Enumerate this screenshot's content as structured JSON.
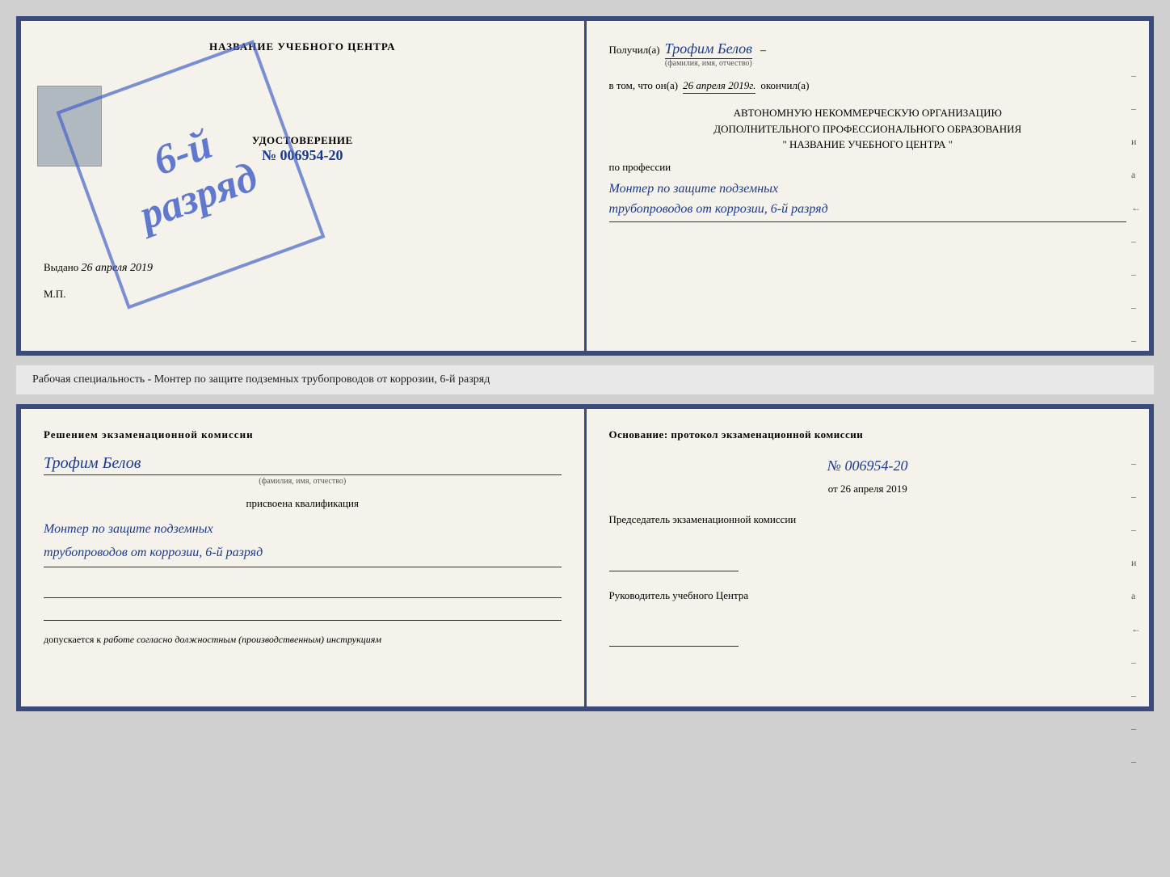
{
  "page": {
    "background": "#d0d0d0"
  },
  "top_doc": {
    "left": {
      "center_title": "НАЗВАНИЕ УЧЕБНОГО ЦЕНТРА",
      "stamp_line1": "6-й",
      "stamp_line2": "разряд",
      "cert_label": "УДОСТОВЕРЕНИЕ",
      "cert_num_prefix": "№",
      "cert_num": "006954-20",
      "issued_prefix": "Выдано",
      "issued_date": "26 апреля 2019",
      "mp_label": "М.П."
    },
    "right": {
      "recipient_prefix": "Получил(а)",
      "recipient_name": "Трофим Белов",
      "recipient_name_sub": "(фамилия, имя, отчество)",
      "date_prefix": "в том, что он(а)",
      "date_val": "26 апреля 2019г.",
      "date_suffix": "окончил(а)",
      "org_line1": "АВТОНОМНУЮ НЕКОММЕРЧЕСКУЮ ОРГАНИЗАЦИЮ",
      "org_line2": "ДОПОЛНИТЕЛЬНОГО ПРОФЕССИОНАЛЬНОГО ОБРАЗОВАНИЯ",
      "org_line3": "\"   НАЗВАНИЕ УЧЕБНОГО ЦЕНТРА   \"",
      "profession_prefix": "по профессии",
      "profession_val1": "Монтер по защите подземных",
      "profession_val2": "трубопроводов от коррозии, 6-й разряд"
    }
  },
  "middle_text": {
    "content": "Рабочая специальность - Монтер по защите подземных трубопроводов от коррозии, 6-й разряд"
  },
  "bottom_doc": {
    "left": {
      "decision_title": "Решением  экзаменационной  комиссии",
      "name": "Трофим Белов",
      "name_sub": "(фамилия, имя, отчество)",
      "assigned_label": "присвоена квалификация",
      "profession_line1": "Монтер по защите подземных",
      "profession_line2": "трубопроводов от коррозии, 6-й разряд",
      "allowed_label": "допускается к",
      "allowed_val": "работе согласно должностным (производственным) инструкциям"
    },
    "right": {
      "basis_title": "Основание: протокол экзаменационной комиссии",
      "basis_num": "№ 006954-20",
      "basis_date_prefix": "от",
      "basis_date": "26 апреля 2019",
      "chairman_label": "Председатель экзаменационной комиссии",
      "director_label": "Руководитель учебного Центра"
    }
  }
}
